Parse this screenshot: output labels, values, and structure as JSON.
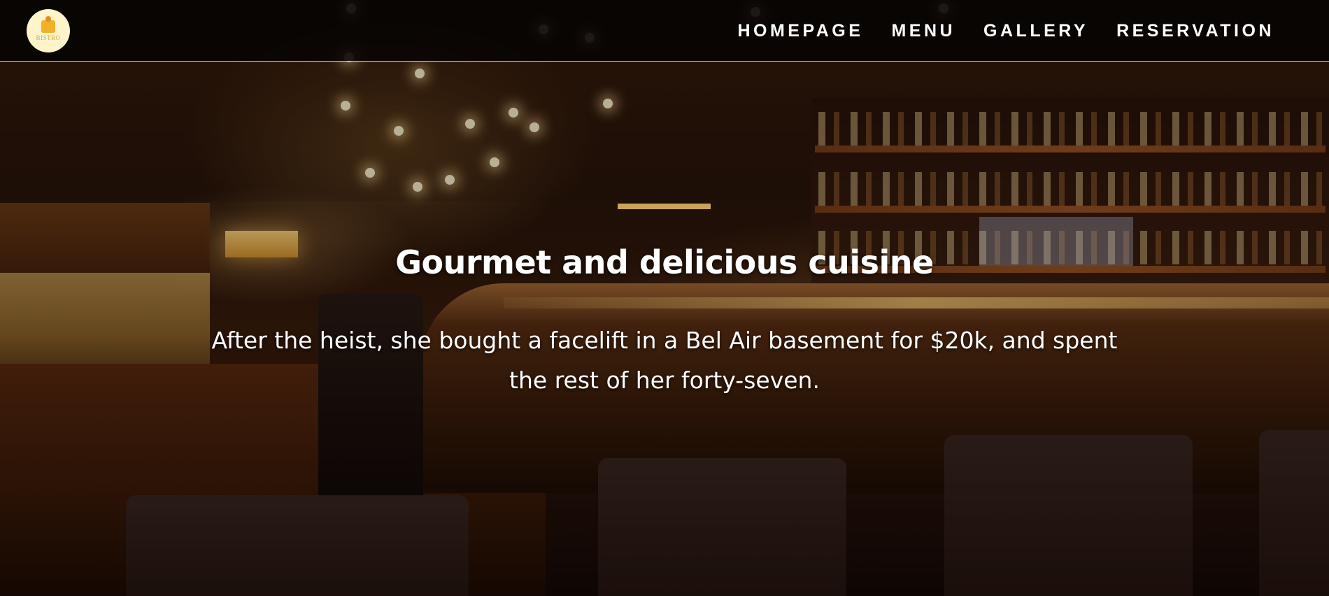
{
  "nav": {
    "logo_text": "BISTRO",
    "links": [
      {
        "label": "HOMEPAGE"
      },
      {
        "label": "MENU"
      },
      {
        "label": "GALLERY"
      },
      {
        "label": "RESERVATION"
      }
    ]
  },
  "hero": {
    "title": "Gourmet and delicious cuisine",
    "subtitle": "After the heist, she bought a facelift in a Bel Air basement for $20k, and spent the rest of her forty-seven.",
    "accent_color": "#c9a45a"
  },
  "icons": {
    "logo": "bistro-logo-icon"
  }
}
